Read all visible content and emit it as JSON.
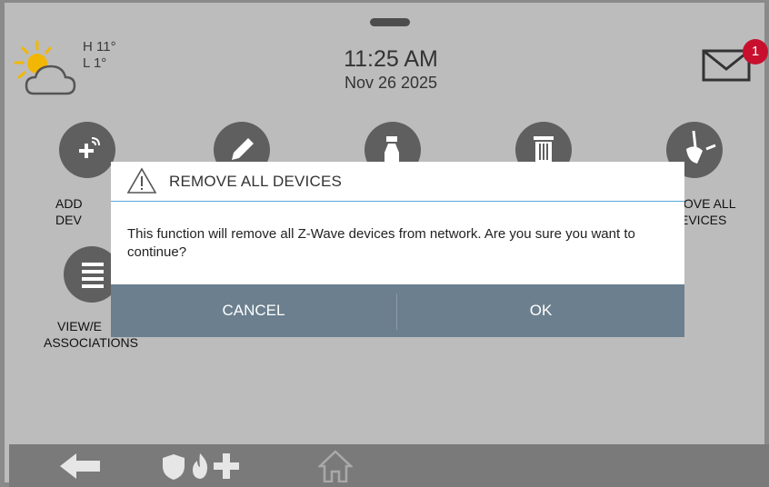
{
  "header": {
    "weather": {
      "high": "H 11°",
      "low": "L 1°",
      "icon": "partly-cloudy-icon"
    },
    "time": "11:25 AM",
    "date": "Nov 26 2025",
    "messages": {
      "icon": "envelope-icon",
      "count": "1"
    }
  },
  "tiles": [
    {
      "name": "add-devices",
      "label_line1": "ADD DEV",
      "label_line2": "",
      "icon": "plus-wireless-icon"
    },
    {
      "name": "edit-device",
      "label_line1": "",
      "label_line2": "",
      "icon": "pencil-icon"
    },
    {
      "name": "clear-failed",
      "label_line1": "",
      "label_line2": "",
      "icon": "spray-bottle-icon"
    },
    {
      "name": "remove-device",
      "label_line1": "",
      "label_line2": "",
      "icon": "trash-icon"
    },
    {
      "name": "remove-all-devices",
      "label_line1": "IOVE ALL",
      "label_line2": "EVICES",
      "icon": "broom-icon"
    },
    {
      "name": "view-edit-associations",
      "label_line1": "VIEW/E",
      "label_line2": "ASSOCIATIONS",
      "icon": "list-icon"
    }
  ],
  "dialog": {
    "title": "REMOVE ALL DEVICES",
    "icon": "warning-icon",
    "message": "This function will remove all Z-Wave devices from network. Are you sure you want to continue?",
    "cancel_label": "CANCEL",
    "ok_label": "OK"
  },
  "footer": {
    "icons": [
      "back-arrow-icon",
      "shield-icon",
      "fire-icon",
      "medical-cross-icon",
      "home-icon"
    ]
  },
  "colors": {
    "background": "#bcbcbc",
    "tile": "#5f5f5f",
    "dialog_buttons": "#6b7f8e",
    "badge": "#c8102e",
    "divider": "#5aa6d6"
  }
}
